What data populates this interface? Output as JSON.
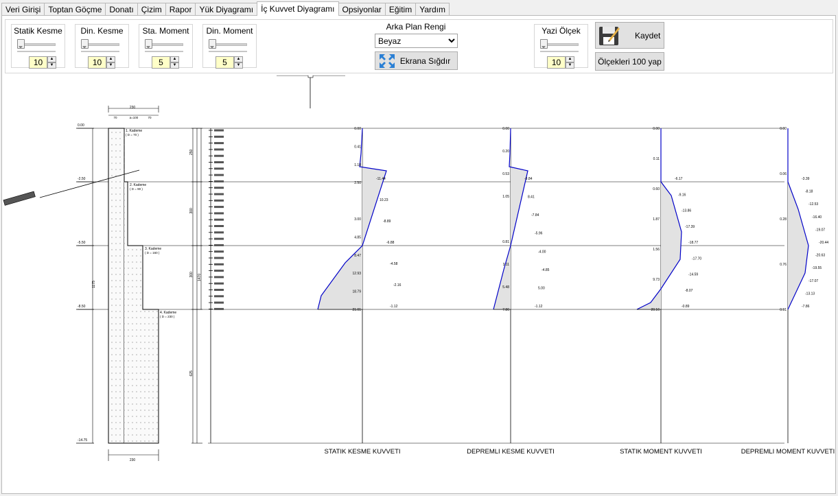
{
  "tabs": [
    "Veri Girişi",
    "Toptan Göçme",
    "Donatı",
    "Çizim",
    "Rapor",
    "Yük Diyagramı",
    "İç Kuvvet Diyagramı",
    "Opsiyonlar",
    "Eğitim",
    "Yardım"
  ],
  "active_tab": 6,
  "toolbar": {
    "scales": [
      {
        "label": "Statik Kesme",
        "value": "10"
      },
      {
        "label": "Din. Kesme",
        "value": "10"
      },
      {
        "label": "Sta. Moment",
        "value": "5"
      },
      {
        "label": "Din. Moment",
        "value": "5"
      }
    ],
    "background": {
      "label": "Arka Plan Rengi",
      "value": "Beyaz",
      "fit_button": "Ekrana Sığdır"
    },
    "font_scale": {
      "label": "Yazi Ölçek",
      "value": "10"
    },
    "save_button": "Kaydet",
    "reset_button": "Ölçekleri 100 yap"
  },
  "drawing": {
    "top_width": "230",
    "top_sub": [
      "70",
      "70",
      "70"
    ],
    "top_sub_mid": "a=100",
    "bottom_width": "230",
    "total_height": "1175",
    "sub_total": "1470",
    "levels": [
      "0.00",
      "-2.50",
      "-5.50",
      "-8.50",
      "-14.75"
    ],
    "segment_heights": [
      "250",
      "300",
      "300",
      "625"
    ],
    "stages": [
      {
        "name": "1. Kademe",
        "dim": "( D = 70 )"
      },
      {
        "name": "2. Kademe",
        "dim": "( D = 90 )"
      },
      {
        "name": "3. Kademe",
        "dim": "( D = 160 )"
      },
      {
        "name": "4. Kademe",
        "dim": "( D = 230 )"
      }
    ],
    "diagrams": [
      {
        "title": "STATIK KESME KUVVETI",
        "left": [
          "0.00",
          "0.41",
          "1.18",
          "2.50",
          "",
          "3.00",
          "4.85",
          "8.47",
          "12.93",
          "18.79",
          "21.01"
        ],
        "right": [
          "-11.44",
          "10.23",
          "-8.89",
          "-6.88",
          "-4.58",
          "-2.16",
          "-1.12"
        ]
      },
      {
        "title": "DEPREMLI KESME KUVVETI",
        "left": [
          "0.00",
          "0.20",
          "0.53",
          "1.05",
          "",
          "0.81",
          "3.11",
          "5.48",
          "7.86"
        ],
        "right": [
          "-9.84",
          "8.41",
          "-7.84",
          "-5.96",
          "-4.00",
          "-4.85",
          "5.00",
          "-1.12"
        ]
      },
      {
        "title": "STATIK MOMENT KUVVETI",
        "left": [
          "0.00",
          "0.11",
          "0.60",
          "1.87",
          "1.56",
          "9.73",
          "20.16"
        ],
        "right": [
          "-6.17",
          "-9.16",
          "-13.86",
          "-17.39",
          "-18.77",
          "-17.70",
          "-14.59",
          "-8.07",
          "-0.89"
        ]
      },
      {
        "title": "DEPREMLI MOMENT KUVVETI",
        "left": [
          "0.00",
          "0.06",
          "0.28",
          "0.76",
          "0.91"
        ],
        "right": [
          "-3.39",
          "-8.18",
          "-12.53",
          "-16.40",
          "-19.07",
          "-20.44",
          "-20.63",
          "-19.55",
          "-17.07",
          "-13.13",
          "-7.86"
        ]
      }
    ]
  },
  "colors": {
    "diagram_fill": "#e2e2e2",
    "curve": "#0000c8",
    "axis": "#000000"
  }
}
